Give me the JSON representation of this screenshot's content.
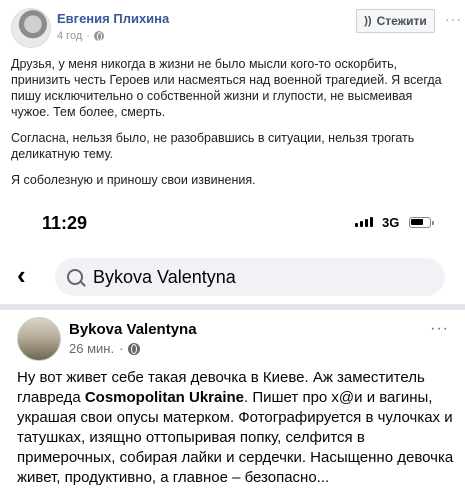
{
  "post": {
    "author": "Евгения Плихина",
    "time": "4 год",
    "follow_label": "Стежити",
    "more": "···",
    "paragraphs": [
      "Друзья, у меня никогда в жизни не было мысли кого-то оскорбить, принизить честь Героев или насмеяться над военной трагедией. Я всегда пишу исключительно о собственной жизни и глупости, не высмеивая чужое. Тем более, смерть.",
      "Согласна, нельзя было, не разобравшись в ситуации, нельзя трогать деликатную тему.",
      "Я соболезную и приношу свои извинения."
    ]
  },
  "phone": {
    "status": {
      "time": "11:29",
      "network": "3G"
    },
    "search": {
      "back": "‹",
      "query": "Bykova Valentyna"
    },
    "post": {
      "author": "Bykova Valentyna",
      "time": "26 мин.",
      "more": "···",
      "text_before_brand": "Ну вот живет себе такая девочка в Киеве. Аж заместитель главреда ",
      "brand": "Cosmopolitan Ukraine",
      "text_after_brand": ". Пишет про х@и и вагины, украшая свои опусы матерком. Фотографируется в чулочках и татушках, изящно оттопыривая попку, селфится в примерочных, собирая лайки и сердечки. Насыщенно девочка живет, продуктивно, а главное – безопасно..."
    }
  }
}
